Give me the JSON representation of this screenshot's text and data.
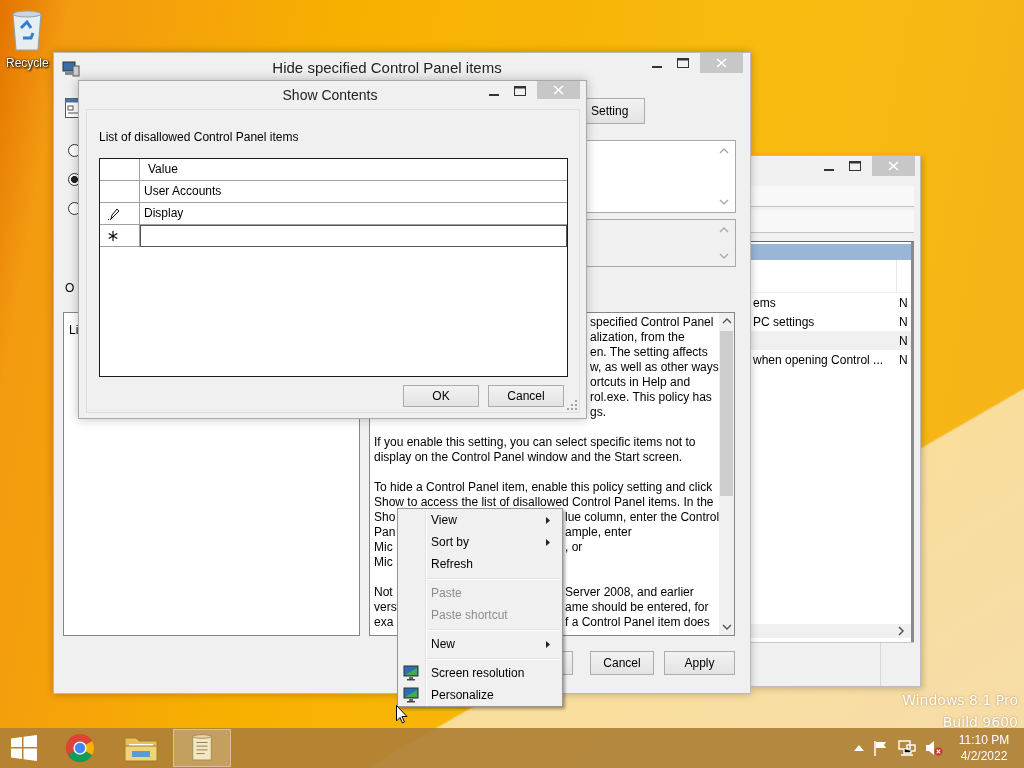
{
  "desktop": {
    "icons": [
      {
        "label": "Recycle"
      }
    ],
    "watermark": [
      "Windows 8.1 Pro",
      "Build 9600"
    ]
  },
  "back_window": {
    "rows": [
      {
        "name": "ems",
        "state": "N",
        "selected": false
      },
      {
        "name": "PC settings",
        "state": "N",
        "selected": false
      },
      {
        "state": "N",
        "selected": true
      },
      {
        "name": "when opening Control ...",
        "state": "N",
        "selected": false
      }
    ]
  },
  "policy_window": {
    "title": "Hide specified Control Panel items",
    "setting_button": "Setting",
    "state_options": [
      {
        "selected": false
      },
      {
        "selected": true
      },
      {
        "selected": false
      }
    ],
    "options_label": "O",
    "options_text": "Li",
    "help_lines": [
      {
        "kind": "right",
        "text": "specified Control Panel"
      },
      {
        "kind": "right",
        "text": "alization, from the"
      },
      {
        "kind": "right",
        "text": "en. The setting affects"
      },
      {
        "kind": "right",
        "text": "w, as well as other ways"
      },
      {
        "kind": "right",
        "text": "ortcuts in Help and"
      },
      {
        "kind": "right",
        "text": "rol.exe. This policy has"
      },
      {
        "kind": "right",
        "text": "gs."
      },
      {
        "kind": "blank"
      },
      {
        "kind": "full",
        "text": "If you enable this setting, you can select specific items not to"
      },
      {
        "kind": "full",
        "text": "display on the Control Panel window and the Start screen."
      },
      {
        "kind": "blank"
      },
      {
        "kind": "full",
        "text": "To hide a Control Panel item, enable this policy setting and click"
      },
      {
        "kind": "full",
        "text": "Show to access the list of disallowed Control Panel items. In the"
      },
      {
        "kind": "split",
        "left": "Sho",
        "right": "lue column, enter the Control"
      },
      {
        "kind": "split",
        "left": "Pan",
        "right": "ample, enter"
      },
      {
        "kind": "split",
        "left": "Mic",
        "right": ", or"
      },
      {
        "kind": "left",
        "text": "Mic"
      },
      {
        "kind": "blank"
      },
      {
        "kind": "split",
        "left": "Not",
        "right": "Server 2008, and earlier"
      },
      {
        "kind": "split",
        "left": "vers",
        "right": "ame should be entered, for"
      },
      {
        "kind": "split",
        "left": "exa",
        "right": "f a Control Panel item does"
      }
    ],
    "buttons": [
      "Cancel",
      "Apply"
    ]
  },
  "show_contents": {
    "title": "Show Contents",
    "label": "List of disallowed Control Panel items",
    "column": "Value",
    "rows": [
      {
        "kind": "item",
        "value": "User Accounts"
      },
      {
        "kind": "editing",
        "value": "Display"
      },
      {
        "kind": "new"
      }
    ],
    "buttons": [
      "OK",
      "Cancel"
    ]
  },
  "context_menu": {
    "items": [
      {
        "kind": "submenu",
        "label": "View",
        "disabled": false
      },
      {
        "kind": "submenu",
        "label": "Sort by",
        "disabled": false
      },
      {
        "kind": "command",
        "label": "Refresh",
        "disabled": false
      },
      {
        "kind": "separator"
      },
      {
        "kind": "command",
        "label": "Paste",
        "disabled": true
      },
      {
        "kind": "command",
        "label": "Paste shortcut",
        "disabled": true
      },
      {
        "kind": "separator"
      },
      {
        "kind": "submenu",
        "label": "New",
        "disabled": false
      },
      {
        "kind": "separator"
      },
      {
        "kind": "display",
        "label": "Screen resolution",
        "disabled": false
      },
      {
        "kind": "display",
        "label": "Personalize",
        "disabled": false
      }
    ]
  },
  "taskbar": {
    "apps": [
      {
        "kind": "browser",
        "active": false
      },
      {
        "kind": "folder",
        "active": false
      },
      {
        "kind": "document",
        "active": true
      }
    ],
    "time": "11:10 PM",
    "date": "4/2/2022"
  }
}
